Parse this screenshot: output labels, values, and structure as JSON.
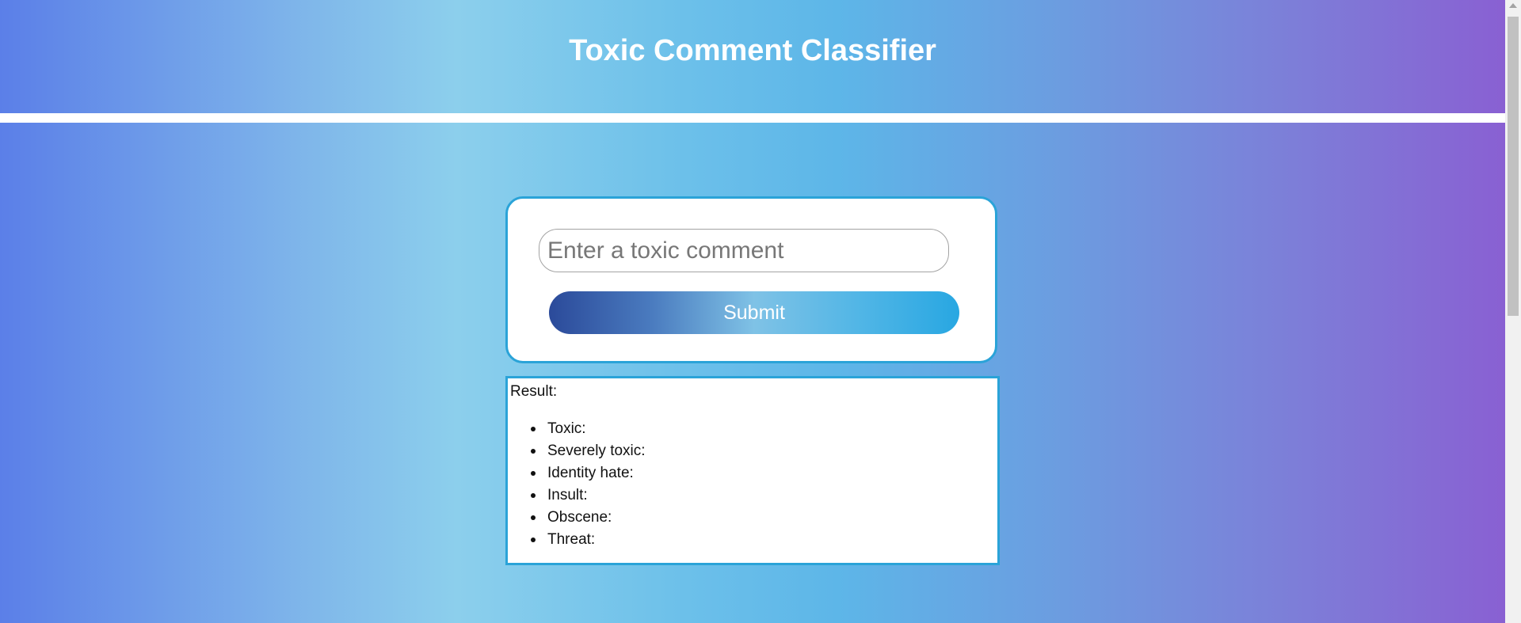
{
  "header": {
    "title": "Toxic Comment Classifier"
  },
  "form": {
    "comment_placeholder": "Enter a toxic comment",
    "comment_value": "",
    "submit_label": "Submit"
  },
  "result": {
    "label": "Result:",
    "items": [
      {
        "label": "Toxic:"
      },
      {
        "label": "Severely toxic:"
      },
      {
        "label": "Identity hate:"
      },
      {
        "label": "Insult:"
      },
      {
        "label": "Obscene:"
      },
      {
        "label": "Threat:"
      }
    ]
  },
  "colors": {
    "accent_border": "#2aa3d8",
    "header_text": "#ffffff"
  },
  "icons": {
    "scroll_up": "scroll-up-arrow-icon"
  }
}
